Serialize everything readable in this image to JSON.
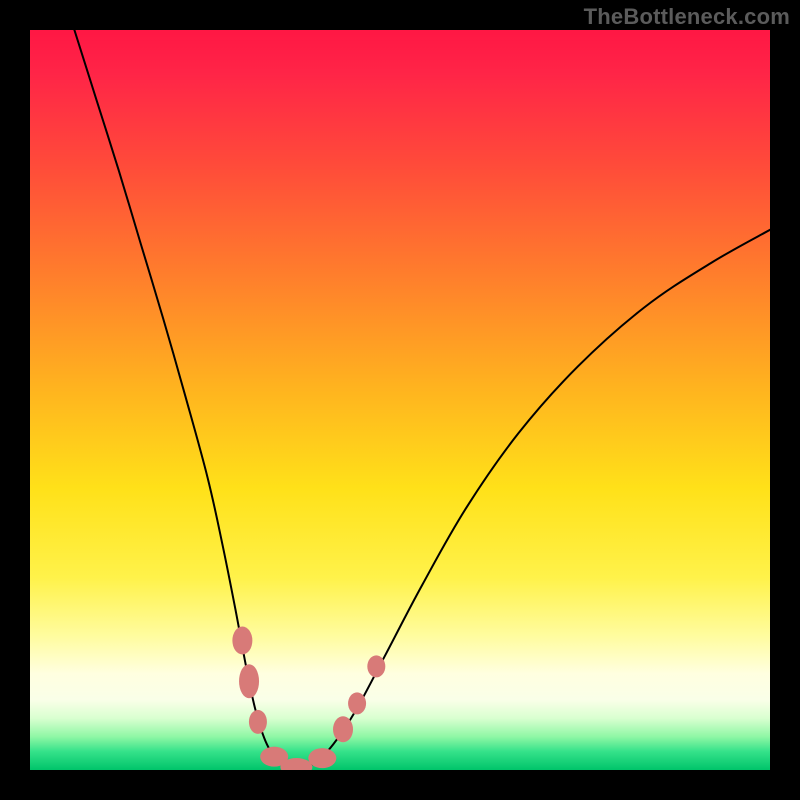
{
  "watermark": "TheBottleneck.com",
  "chart_data": {
    "type": "line",
    "title": "",
    "xlabel": "",
    "ylabel": "",
    "xlim": [
      0,
      1
    ],
    "ylim": [
      0,
      1
    ],
    "background_gradient": {
      "stops": [
        {
          "offset": 0.0,
          "color": "#ff1744"
        },
        {
          "offset": 0.06,
          "color": "#ff2547"
        },
        {
          "offset": 0.18,
          "color": "#ff4a3a"
        },
        {
          "offset": 0.32,
          "color": "#ff7a2d"
        },
        {
          "offset": 0.48,
          "color": "#ffb21f"
        },
        {
          "offset": 0.62,
          "color": "#ffe119"
        },
        {
          "offset": 0.74,
          "color": "#fff24a"
        },
        {
          "offset": 0.82,
          "color": "#fffca0"
        },
        {
          "offset": 0.87,
          "color": "#ffffe0"
        },
        {
          "offset": 0.905,
          "color": "#faffe8"
        },
        {
          "offset": 0.93,
          "color": "#d9ffd0"
        },
        {
          "offset": 0.955,
          "color": "#8ff7a5"
        },
        {
          "offset": 0.975,
          "color": "#35e28a"
        },
        {
          "offset": 1.0,
          "color": "#00c46a"
        }
      ]
    },
    "series": [
      {
        "name": "bottleneck-curve",
        "x": [
          0.06,
          0.09,
          0.12,
          0.15,
          0.18,
          0.21,
          0.24,
          0.26,
          0.278,
          0.292,
          0.305,
          0.32,
          0.338,
          0.36,
          0.385,
          0.41,
          0.44,
          0.48,
          0.53,
          0.59,
          0.66,
          0.74,
          0.83,
          0.92,
          1.0
        ],
        "y": [
          1.0,
          0.905,
          0.81,
          0.71,
          0.61,
          0.505,
          0.395,
          0.305,
          0.215,
          0.14,
          0.08,
          0.035,
          0.01,
          0.0,
          0.01,
          0.035,
          0.08,
          0.155,
          0.25,
          0.355,
          0.455,
          0.545,
          0.625,
          0.685,
          0.73
        ]
      }
    ],
    "markers": {
      "name": "highlight-points",
      "color": "#d87a78",
      "points": [
        {
          "x": 0.287,
          "y": 0.175,
          "rx": 10,
          "ry": 14
        },
        {
          "x": 0.296,
          "y": 0.12,
          "rx": 10,
          "ry": 17
        },
        {
          "x": 0.308,
          "y": 0.065,
          "rx": 9,
          "ry": 12
        },
        {
          "x": 0.33,
          "y": 0.018,
          "rx": 14,
          "ry": 10
        },
        {
          "x": 0.36,
          "y": 0.004,
          "rx": 16,
          "ry": 9
        },
        {
          "x": 0.395,
          "y": 0.016,
          "rx": 14,
          "ry": 10
        },
        {
          "x": 0.423,
          "y": 0.055,
          "rx": 10,
          "ry": 13
        },
        {
          "x": 0.442,
          "y": 0.09,
          "rx": 9,
          "ry": 11
        },
        {
          "x": 0.468,
          "y": 0.14,
          "rx": 9,
          "ry": 11
        }
      ]
    }
  }
}
